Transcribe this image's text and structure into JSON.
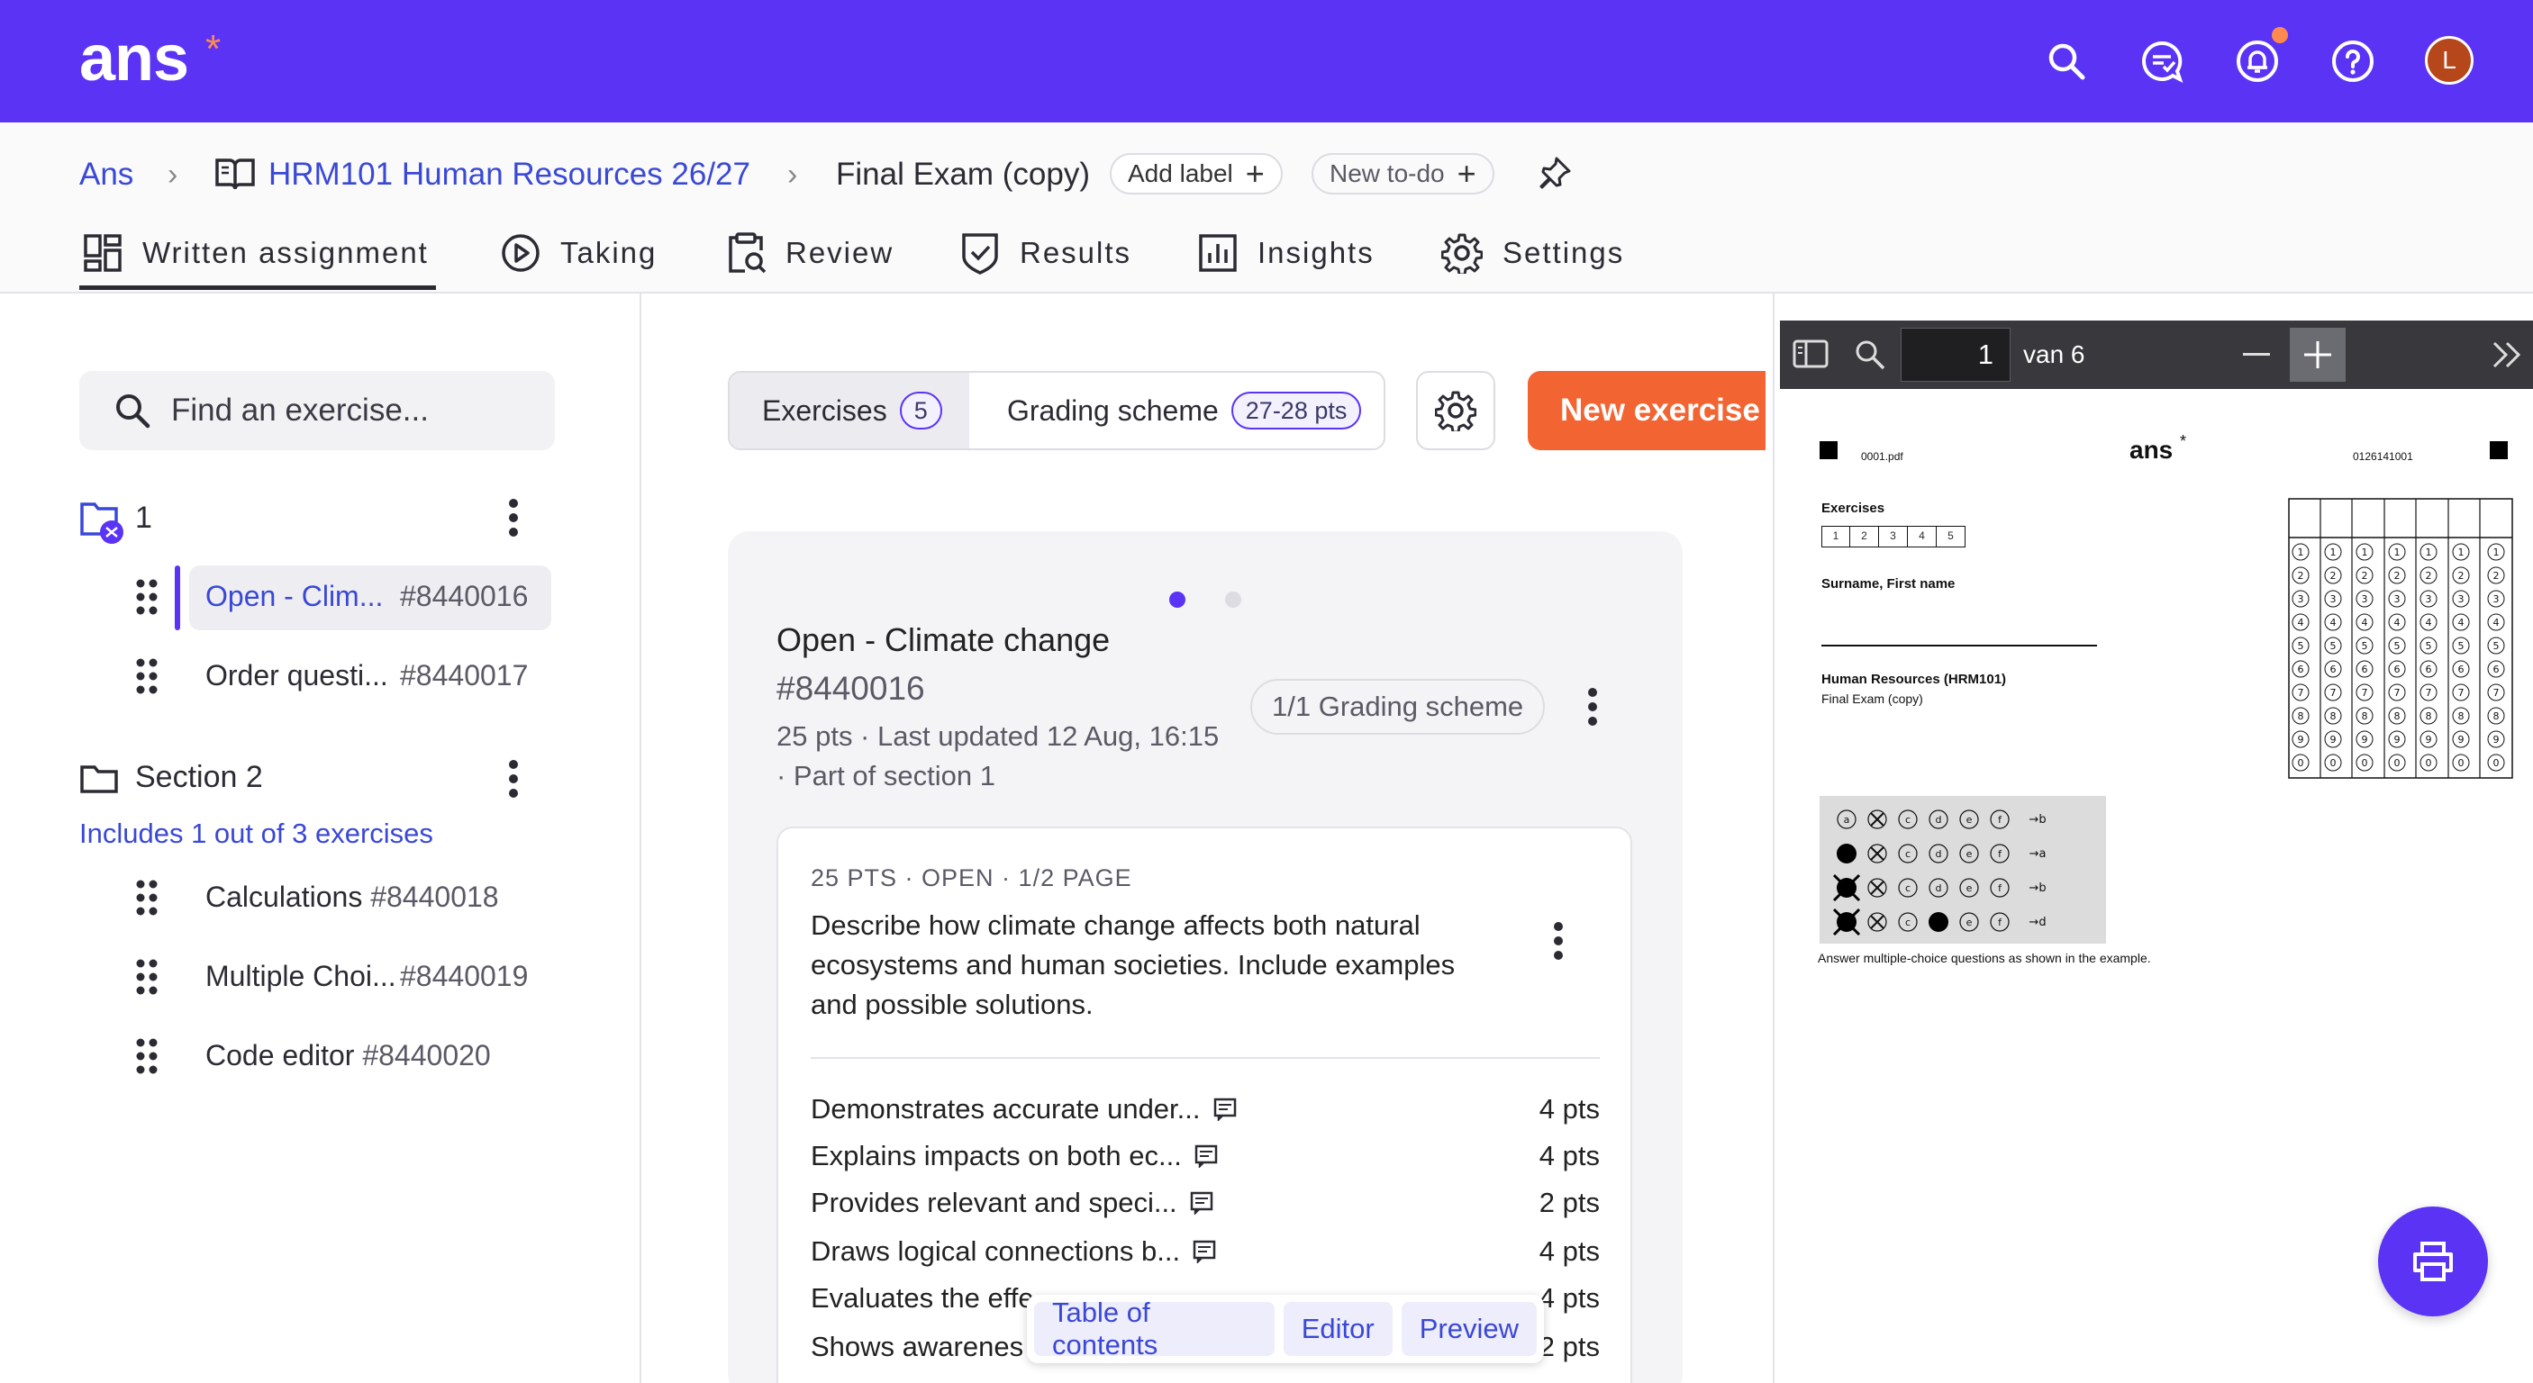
{
  "topbar": {
    "logo": "ans",
    "logo_star": "*",
    "avatar_initial": "L",
    "colors": {
      "bar": "#5b33f5",
      "accent": "#ff8a50",
      "avatar": "#b6471a"
    }
  },
  "breadcrumb": {
    "root": "Ans",
    "course": "HRM101 Human Resources 26/27",
    "current": "Final Exam (copy)",
    "add_label": "Add label",
    "new_todo": "New to-do"
  },
  "tabs": [
    "Written assignment",
    "Taking",
    "Review",
    "Results",
    "Insights",
    "Settings"
  ],
  "sidebar": {
    "search_placeholder": "Find an exercise...",
    "section1": {
      "title": "1",
      "items": [
        {
          "name": "Open - Clim...",
          "id": "#8440016"
        },
        {
          "name": "Order questi...",
          "id": "#8440017"
        }
      ]
    },
    "section2": {
      "title": "Section 2",
      "subtitle": "Includes 1 out of 3 exercises",
      "items": [
        {
          "name": "Calculations",
          "id": "#8440018"
        },
        {
          "name": "Multiple Choi...",
          "id": "#8440019"
        },
        {
          "name": "Code editor",
          "id": "#8440020"
        }
      ]
    }
  },
  "main": {
    "seg_exercises": "Exercises",
    "seg_exercises_count": "5",
    "seg_grading": "Grading scheme",
    "seg_grading_pts": "27-28 pts",
    "new_exercise": "New exercise",
    "card": {
      "title": "Open - Climate change",
      "id": "#8440016",
      "meta1": "25 pts · Last updated 12 Aug, 16:15",
      "meta2": "· Part of section 1",
      "grading_pill": "1/1 Grading scheme",
      "inner_meta": "25 PTS · OPEN · 1/2 PAGE",
      "question": "Describe how climate change affects both natural ecosystems and human societies. Include examples and possible solutions.",
      "criteria": [
        {
          "label": "Demonstrates accurate under...",
          "pts": "4 pts"
        },
        {
          "label": "Explains impacts on both ec...",
          "pts": "4 pts"
        },
        {
          "label": "Provides relevant and speci...",
          "pts": "2 pts"
        },
        {
          "label": "Draws logical connections b...",
          "pts": "4 pts"
        },
        {
          "label": "Evaluates the effe",
          "pts": "4 pts"
        },
        {
          "label": "Shows awarenes",
          "pts": "2 pts"
        }
      ]
    },
    "floating": {
      "toc": "Table of contents",
      "editor": "Editor",
      "preview": "Preview"
    }
  },
  "pdf": {
    "page": "1",
    "of": "van 6",
    "file": "0001.pdf",
    "logo": "ans",
    "code": "0126141001",
    "exercises_label": "Exercises",
    "exercise_boxes": [
      "1",
      "2",
      "3",
      "4",
      "5"
    ],
    "name_label": "Surname, First name",
    "course": "Human Resources (HRM101)",
    "exam": "Final Exam (copy)",
    "digits": [
      "1",
      "2",
      "3",
      "4",
      "5",
      "6",
      "7",
      "8",
      "9",
      "0"
    ],
    "example_rows": [
      "→b",
      "→a",
      "→b",
      "→d"
    ],
    "example_letters": [
      "a",
      "b",
      "c",
      "d",
      "e",
      "f"
    ],
    "instruction": "Answer multiple-choice questions as shown in the example."
  }
}
